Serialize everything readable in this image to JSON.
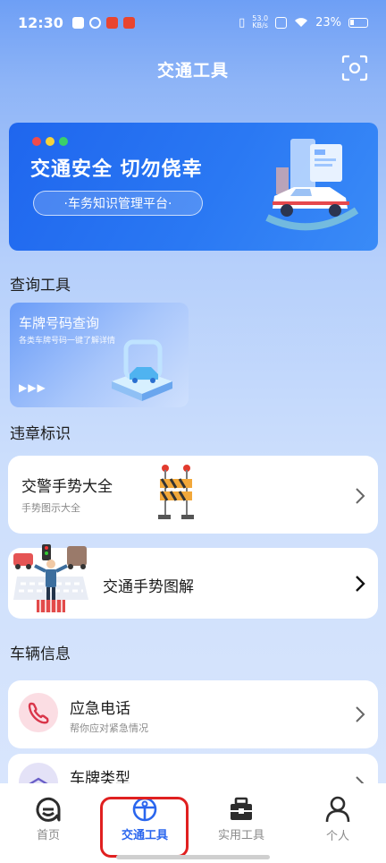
{
  "status_bar": {
    "time": "12:30",
    "net_speed_value": "53.0",
    "net_speed_unit": "KB/s",
    "battery": "23%"
  },
  "header": {
    "title": "交通工具"
  },
  "banner": {
    "title": "交通安全  切勿侥幸",
    "pill": "·车务知识管理平台·"
  },
  "sections": {
    "query": "查询工具",
    "violation": "违章标识",
    "vehicle": "车辆信息"
  },
  "query_card": {
    "title": "车牌号码查询",
    "subtitle": "各类车牌号码一键了解详情",
    "arrows": "▶▶▶"
  },
  "gesture_card": {
    "title": "交警手势大全",
    "subtitle": "手势图示大全"
  },
  "gesture_graphic_card": {
    "title": "交通手势图解"
  },
  "emergency_card": {
    "title": "应急电话",
    "subtitle": "帮你应对紧急情况"
  },
  "plate_type_card": {
    "title": "车牌类型"
  },
  "tabbar": {
    "items": [
      "首页",
      "交通工具",
      "实用工具",
      "个人"
    ],
    "active": "交通工具"
  },
  "colors": {
    "accent": "#2a66ee",
    "highlight": "#e02020"
  }
}
